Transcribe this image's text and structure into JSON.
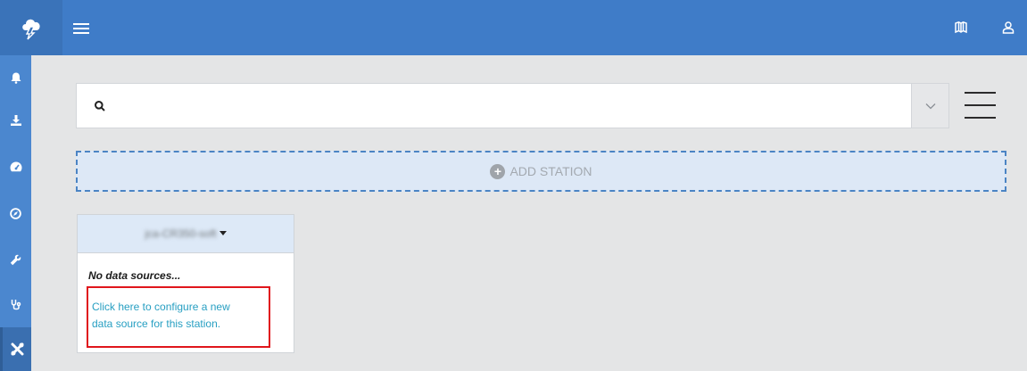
{
  "header": {
    "logo_icon": "cloud-bolt-icon",
    "menu_icon": "hamburger-icon",
    "right_icons": [
      "book-icon",
      "user-icon"
    ],
    "bg_color": "#3f7cc8"
  },
  "sidebar": {
    "items": [
      {
        "icon": "bell-icon"
      },
      {
        "icon": "download-icon"
      },
      {
        "icon": "dashboard-icon"
      },
      {
        "icon": "compass-icon"
      },
      {
        "icon": "wrench-icon"
      },
      {
        "icon": "stethoscope-icon"
      },
      {
        "icon": "tools-icon",
        "active": true
      }
    ]
  },
  "search": {
    "value": "",
    "placeholder": ""
  },
  "add_station": {
    "label": "ADD STATION"
  },
  "station_card": {
    "name": "jca-CR350-soft",
    "no_data_text": "No data sources...",
    "configure_link_line1": "Click here to configure a new",
    "configure_link_line2": "data source for this station."
  },
  "colors": {
    "accent": "#3f7cc8",
    "link": "#279fc2",
    "highlight": "#e0161c"
  }
}
